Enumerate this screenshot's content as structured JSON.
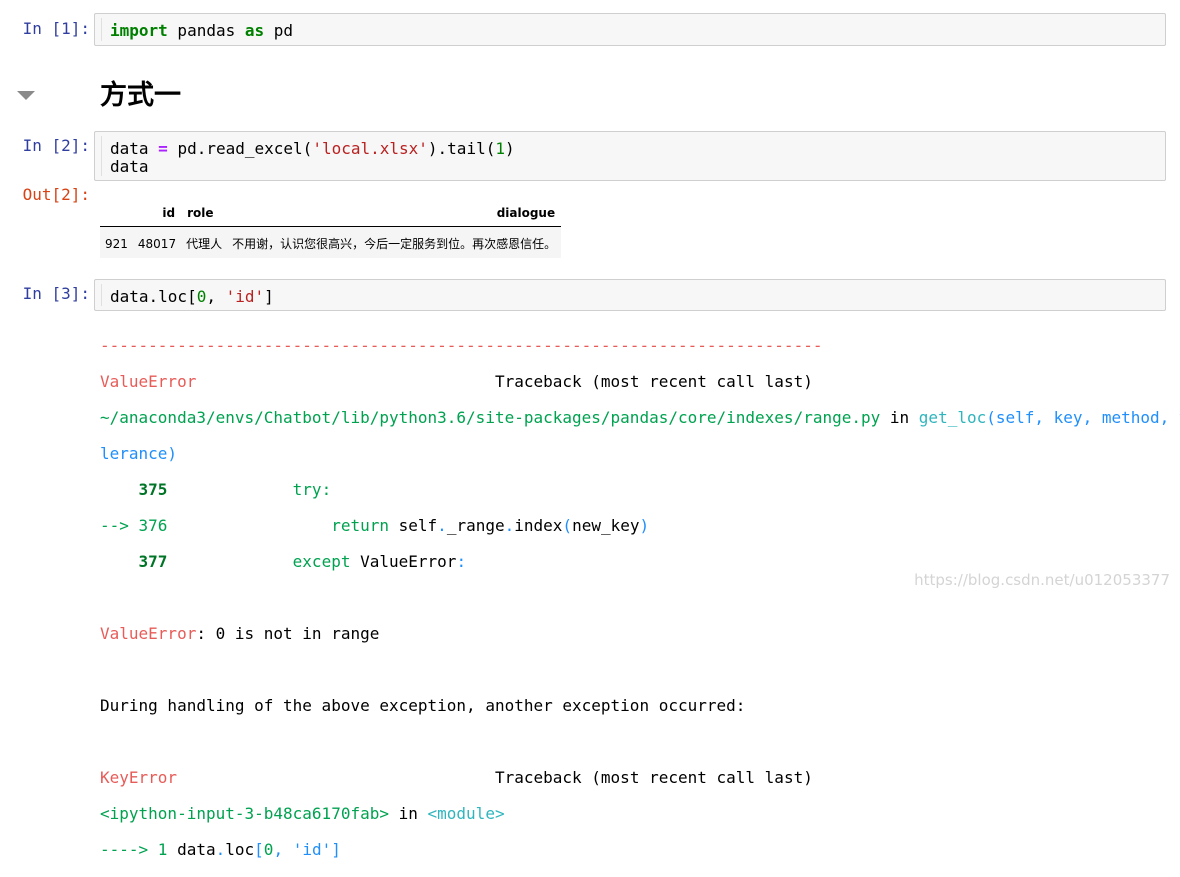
{
  "cells": {
    "c1": {
      "prompt": "In [1]:",
      "kw1": "import",
      "mod": " pandas ",
      "kw2": "as",
      "alias": " pd"
    },
    "heading": "方式一",
    "c2": {
      "prompt": "In [2]:",
      "l1_a": "data ",
      "l1_op": "=",
      "l1_b": " pd.read_excel(",
      "l1_str": "'local.xlsx'",
      "l1_c": ").tail(",
      "l1_num": "1",
      "l1_d": ")",
      "l2": "data",
      "out_prompt": "Out[2]:"
    },
    "c3": {
      "prompt": "In [3]:",
      "a": "data.loc[",
      "num": "0",
      "b": ", ",
      "str": "'id'",
      "c": "]"
    }
  },
  "dataframe": {
    "headers": {
      "index": "",
      "id": "id",
      "role": "role",
      "dialogue": "dialogue"
    },
    "row": {
      "index": "921",
      "id": "48017",
      "role": "代理人",
      "dialogue": "不用谢，认识您很高兴，今后一定服务到位。再次感恩信任。"
    }
  },
  "traceback": {
    "sep": "---------------------------------------------------------------------------",
    "err1_name": "ValueError",
    "err1_pad": "                               ",
    "tb_header": "Traceback (most recent call last)",
    "path": "~/anaconda3/envs/Chatbot/lib/python3.6/site-packages/pandas/core/indexes/range.py",
    "in_word": " in ",
    "func": "get_loc",
    "args1": "(self, key, method, to",
    "args2": "lerance)",
    "l375_no": "    375",
    "l375_code": "             try:",
    "arrow376": "--> 376",
    "l376_kw": "                 return",
    "l376_a": " self",
    "l376_dot1": ".",
    "l376_b": "_range",
    "l376_dot2": ".",
    "l376_c": "index",
    "l376_p1": "(",
    "l376_d": "new_key",
    "l376_p2": ")",
    "l377_no": "    377",
    "l377_kw": "             except",
    "l377_b": " ValueError",
    "l377_colon": ":",
    "msg_name": "ValueError",
    "msg_text": ": 0 is not in range",
    "during": "During handling of the above exception, another exception occurred:",
    "err2_name": "KeyError",
    "err2_pad": "                                 ",
    "input_ref": "<ipython-input-3-b48ca6170fab>",
    "module": "<module>",
    "arrow1": "----> 1",
    "f_a": " data",
    "f_dot": ".",
    "f_b": "loc",
    "f_br1": "[",
    "f_num": "0",
    "f_comma": ", ",
    "f_str": "'id'",
    "f_br2": "]"
  },
  "watermark": "https://blog.csdn.net/u012053377",
  "colors": {
    "in_prompt": "#303f9f",
    "out_prompt": "#d84315",
    "ansi_red": "#e75c58",
    "ansi_green": "#00a250",
    "ansi_cyan": "#2fb5bd",
    "ansi_blue": "#208ffb"
  }
}
